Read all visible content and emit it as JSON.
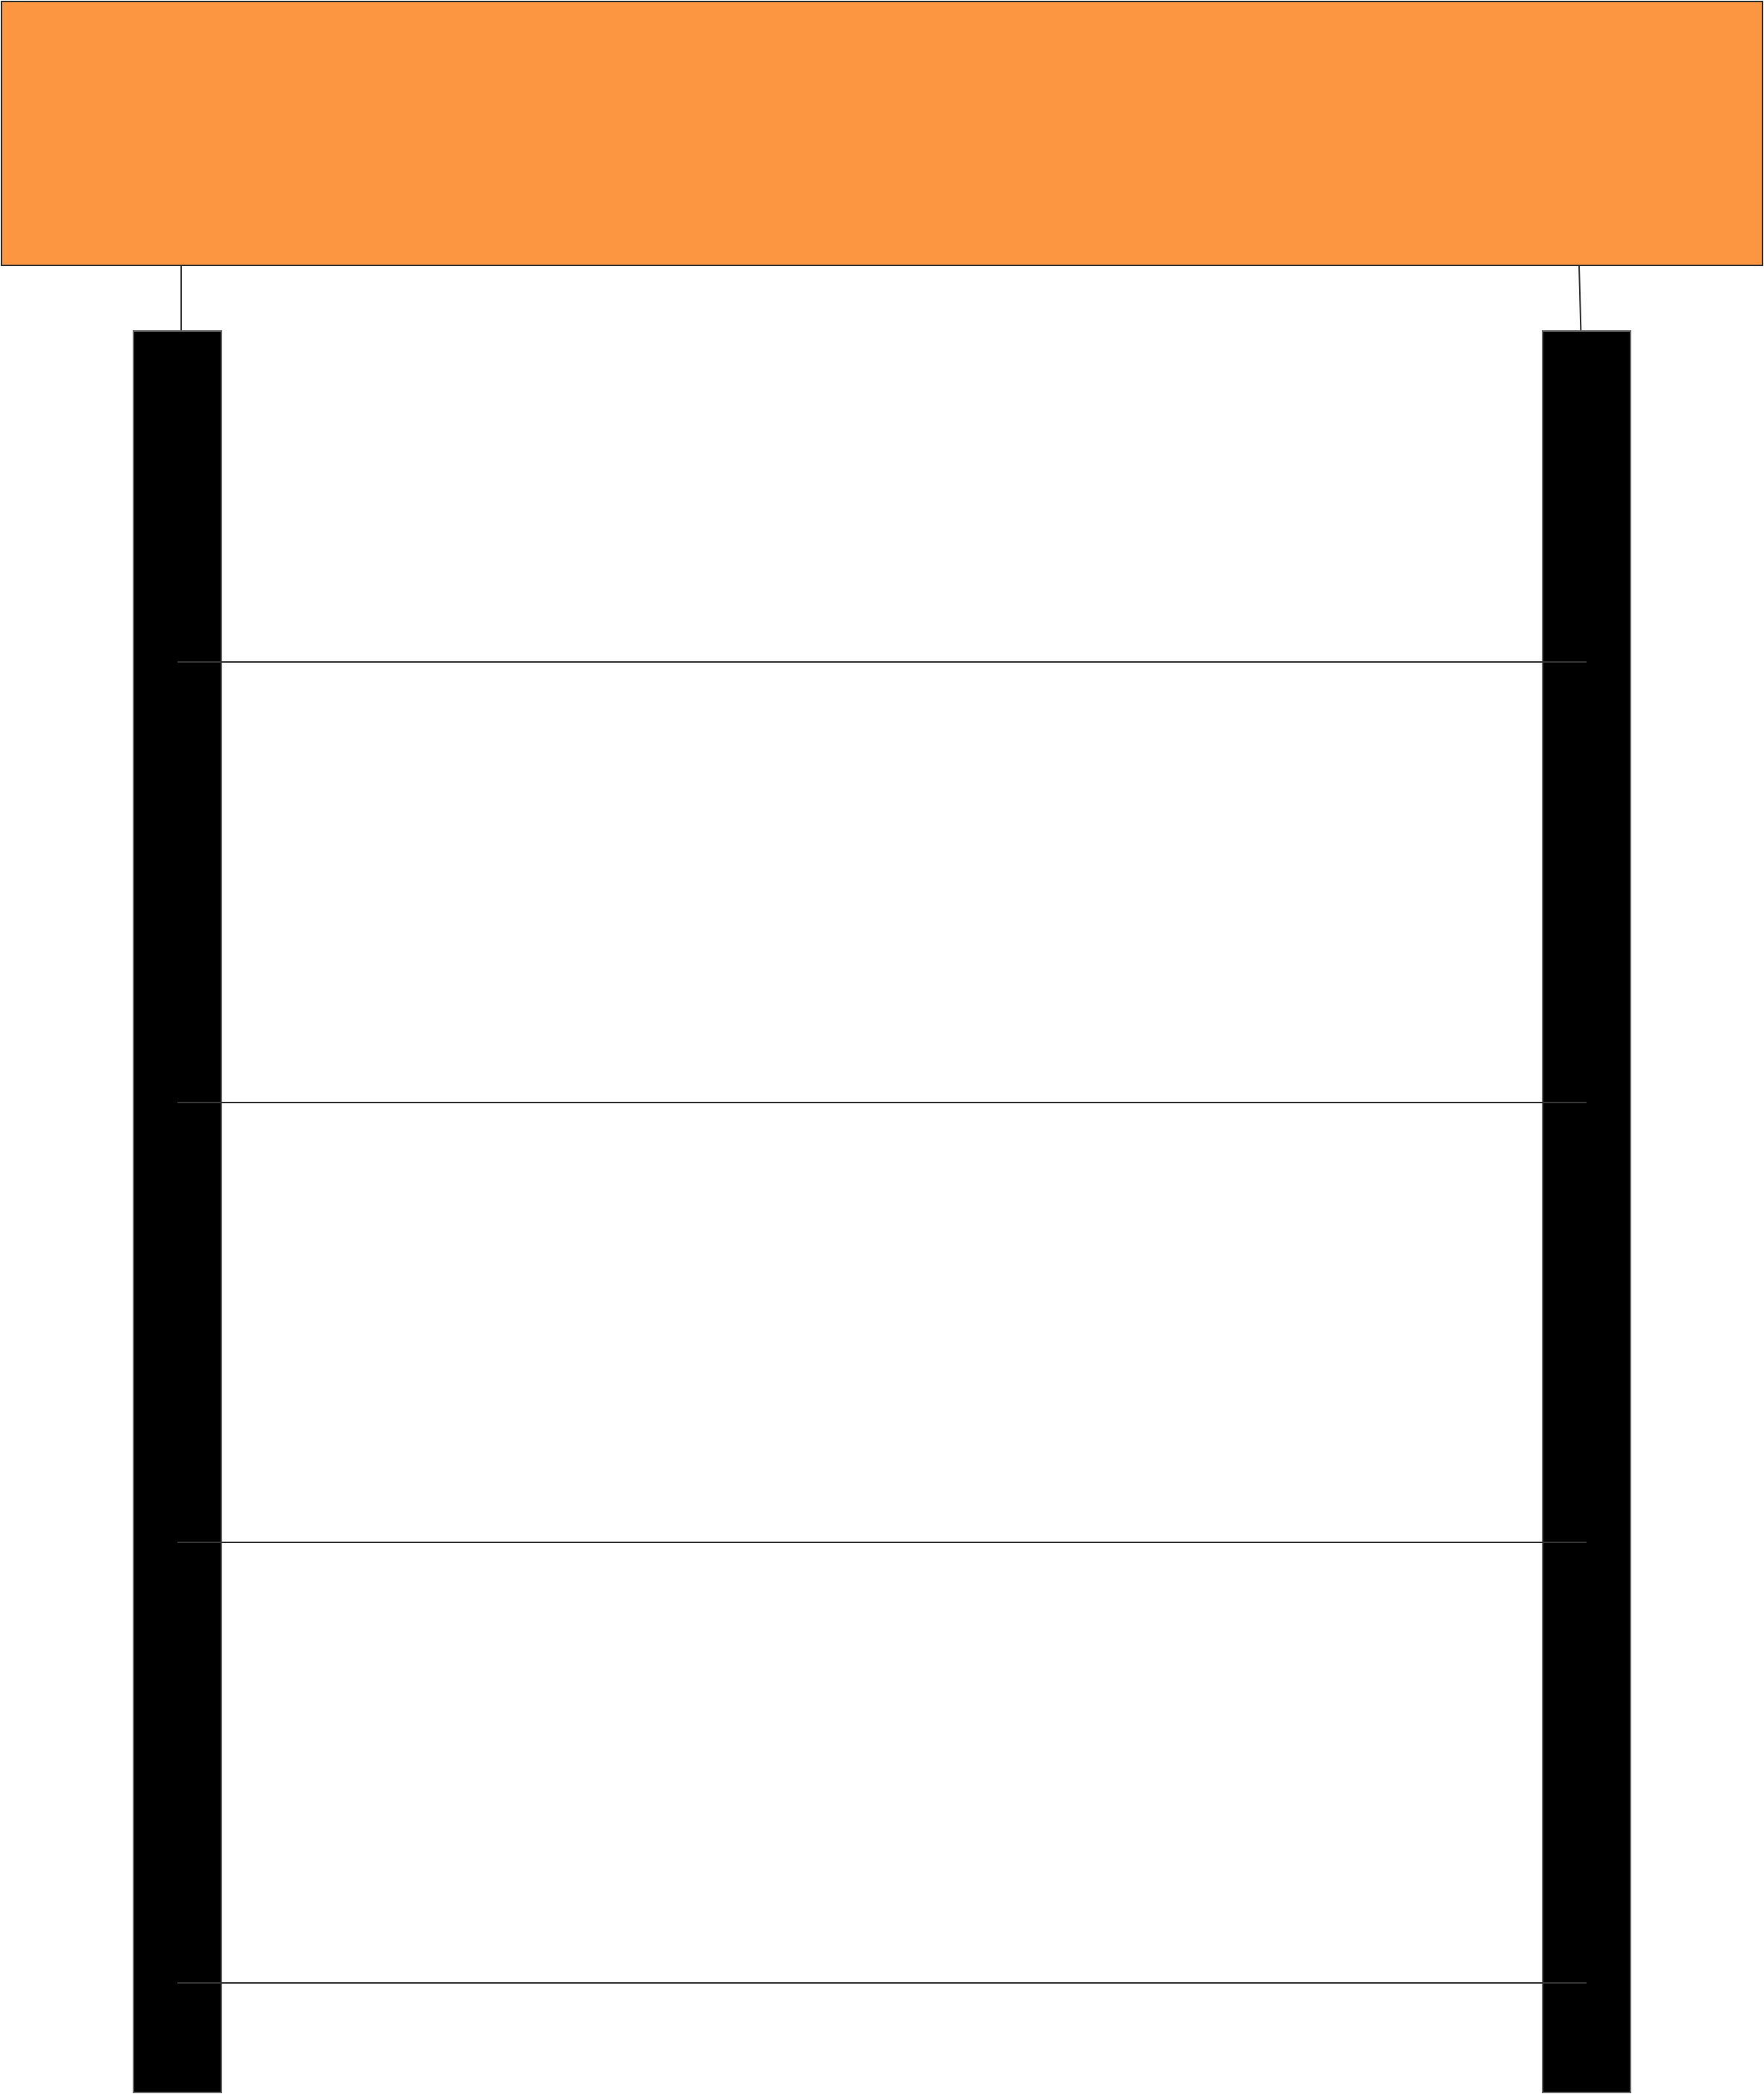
{
  "colors": {
    "header_fill": "#FD9640",
    "header_stroke": "#333333",
    "lifeline_fill": "#000000",
    "lifeline_stroke": "#666666",
    "message_stroke": "#333333",
    "background": "#FFFFFF"
  },
  "diagram": {
    "header_label": "",
    "lifelines": [
      "",
      ""
    ],
    "messages": [
      {
        "label": ""
      },
      {
        "label": ""
      },
      {
        "label": ""
      },
      {
        "label": ""
      }
    ]
  }
}
